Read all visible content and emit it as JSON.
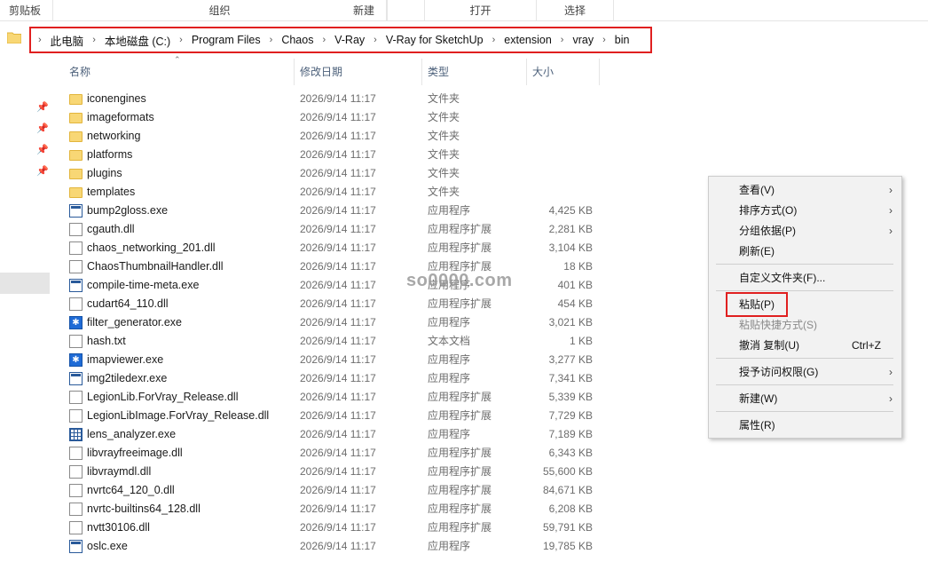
{
  "ribbon": [
    "剪贴板",
    "组织",
    "新建",
    "打开",
    "选择"
  ],
  "breadcrumb": [
    "此电脑",
    "本地磁盘 (C:)",
    "Program Files",
    "Chaos",
    "V-Ray",
    "V-Ray for SketchUp",
    "extension",
    "vray",
    "bin"
  ],
  "columns": {
    "name": "名称",
    "date": "修改日期",
    "type": "类型",
    "size": "大小"
  },
  "files": [
    {
      "name": "iconengines",
      "date": "2026/9/14 11:17",
      "type": "文件夹",
      "size": "",
      "icon": "folder"
    },
    {
      "name": "imageformats",
      "date": "2026/9/14 11:17",
      "type": "文件夹",
      "size": "",
      "icon": "folder"
    },
    {
      "name": "networking",
      "date": "2026/9/14 11:17",
      "type": "文件夹",
      "size": "",
      "icon": "folder"
    },
    {
      "name": "platforms",
      "date": "2026/9/14 11:17",
      "type": "文件夹",
      "size": "",
      "icon": "folder"
    },
    {
      "name": "plugins",
      "date": "2026/9/14 11:17",
      "type": "文件夹",
      "size": "",
      "icon": "folder"
    },
    {
      "name": "templates",
      "date": "2026/9/14 11:17",
      "type": "文件夹",
      "size": "",
      "icon": "folder"
    },
    {
      "name": "bump2gloss.exe",
      "date": "2026/9/14 11:17",
      "type": "应用程序",
      "size": "4,425 KB",
      "icon": "exe"
    },
    {
      "name": "cgauth.dll",
      "date": "2026/9/14 11:17",
      "type": "应用程序扩展",
      "size": "2,281 KB",
      "icon": "file"
    },
    {
      "name": "chaos_networking_201.dll",
      "date": "2026/9/14 11:17",
      "type": "应用程序扩展",
      "size": "3,104 KB",
      "icon": "file"
    },
    {
      "name": "ChaosThumbnailHandler.dll",
      "date": "2026/9/14 11:17",
      "type": "应用程序扩展",
      "size": "18 KB",
      "icon": "file"
    },
    {
      "name": "compile-time-meta.exe",
      "date": "2026/9/14 11:17",
      "type": "应用程序",
      "size": "401 KB",
      "icon": "exe"
    },
    {
      "name": "cudart64_110.dll",
      "date": "2026/9/14 11:17",
      "type": "应用程序扩展",
      "size": "454 KB",
      "icon": "file"
    },
    {
      "name": "filter_generator.exe",
      "date": "2026/9/14 11:17",
      "type": "应用程序",
      "size": "3,021 KB",
      "icon": "blue"
    },
    {
      "name": "hash.txt",
      "date": "2026/9/14 11:17",
      "type": "文本文档",
      "size": "1 KB",
      "icon": "file"
    },
    {
      "name": "imapviewer.exe",
      "date": "2026/9/14 11:17",
      "type": "应用程序",
      "size": "3,277 KB",
      "icon": "blue"
    },
    {
      "name": "img2tiledexr.exe",
      "date": "2026/9/14 11:17",
      "type": "应用程序",
      "size": "7,341 KB",
      "icon": "exe"
    },
    {
      "name": "LegionLib.ForVray_Release.dll",
      "date": "2026/9/14 11:17",
      "type": "应用程序扩展",
      "size": "5,339 KB",
      "icon": "file"
    },
    {
      "name": "LegionLibImage.ForVray_Release.dll",
      "date": "2026/9/14 11:17",
      "type": "应用程序扩展",
      "size": "7,729 KB",
      "icon": "file"
    },
    {
      "name": "lens_analyzer.exe",
      "date": "2026/9/14 11:17",
      "type": "应用程序",
      "size": "7,189 KB",
      "icon": "grid"
    },
    {
      "name": "libvrayfreeimage.dll",
      "date": "2026/9/14 11:17",
      "type": "应用程序扩展",
      "size": "6,343 KB",
      "icon": "file"
    },
    {
      "name": "libvraymdl.dll",
      "date": "2026/9/14 11:17",
      "type": "应用程序扩展",
      "size": "55,600 KB",
      "icon": "file"
    },
    {
      "name": "nvrtc64_120_0.dll",
      "date": "2026/9/14 11:17",
      "type": "应用程序扩展",
      "size": "84,671 KB",
      "icon": "file"
    },
    {
      "name": "nvrtc-builtins64_128.dll",
      "date": "2026/9/14 11:17",
      "type": "应用程序扩展",
      "size": "6,208 KB",
      "icon": "file"
    },
    {
      "name": "nvtt30106.dll",
      "date": "2026/9/14 11:17",
      "type": "应用程序扩展",
      "size": "59,791 KB",
      "icon": "file"
    },
    {
      "name": "oslc.exe",
      "date": "2026/9/14 11:17",
      "type": "应用程序",
      "size": "19,785 KB",
      "icon": "exe"
    }
  ],
  "watermark": "so0000.com",
  "context_menu": {
    "view": "查看(V)",
    "sort": "排序方式(O)",
    "group": "分组依据(P)",
    "refresh": "刷新(E)",
    "customize": "自定义文件夹(F)...",
    "paste": "粘贴(P)",
    "paste_shortcut": "粘贴快捷方式(S)",
    "undo": "撤消 复制(U)",
    "undo_shortcut": "Ctrl+Z",
    "grant_access": "授予访问权限(G)",
    "new": "新建(W)",
    "properties": "属性(R)"
  },
  "colors": {
    "highlight_red": "#e02020",
    "header_text": "#4c607a",
    "folder_yellow": "#f8d775"
  }
}
